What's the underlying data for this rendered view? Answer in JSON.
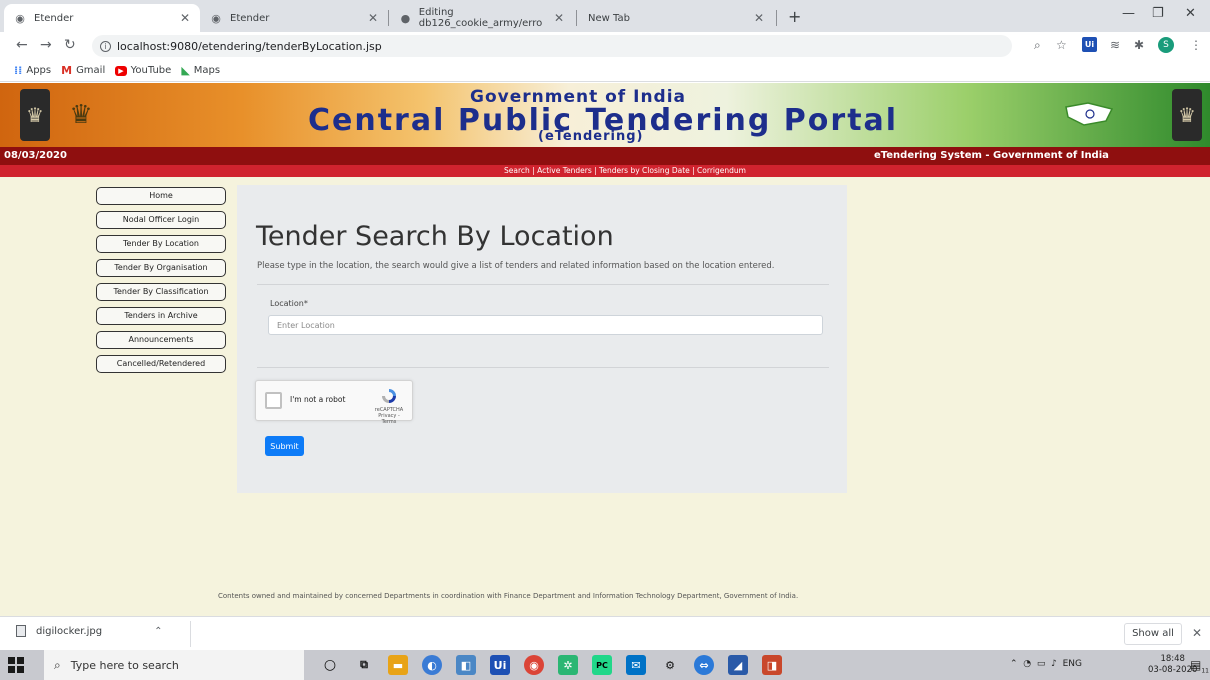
{
  "browser": {
    "tabs": [
      {
        "title": "Etender"
      },
      {
        "title": "Etender"
      },
      {
        "title": "Editing db126_cookie_army/erro"
      },
      {
        "title": "New Tab"
      }
    ],
    "new_tab_label": "+",
    "url": "localhost:9080/etendering/tenderByLocation.jsp",
    "bookmarks": [
      {
        "label": "Apps",
        "icon": "apps-grid-icon"
      },
      {
        "label": "Gmail",
        "icon": "gmail-icon"
      },
      {
        "label": "YouTube",
        "icon": "youtube-icon"
      },
      {
        "label": "Maps",
        "icon": "maps-icon"
      }
    ],
    "profile_initial": "S",
    "ui_extension_label": "Ui"
  },
  "page": {
    "header": {
      "line1": "Government of India",
      "line2": "Central Public Tendering Portal",
      "line3": "(eTendering)"
    },
    "date": "08/03/2020",
    "system_title": "eTendering System - Government of India",
    "links": "Search | Active Tenders | Tenders by Closing Date | Corrigendum",
    "nav": [
      "Home",
      "Nodal Officer Login",
      "Tender By Location",
      "Tender By Organisation",
      "Tender By Classification",
      "Tenders in Archive",
      "Announcements",
      "Cancelled/Retendered"
    ],
    "main": {
      "title": "Tender Search By Location",
      "description": "Please type in the location, the search would give a list of tenders and related information based on the location entered.",
      "location_label": "Location*",
      "location_placeholder": "Enter Location",
      "location_value": "",
      "captcha_text": "I'm not a robot",
      "captcha_brand": "reCAPTCHA",
      "captcha_links": "Privacy - Terms",
      "submit_label": "Submit"
    },
    "footer": "Contents owned and maintained by concerned Departments in coordination with Finance Department and Information Technology Department, Government of India."
  },
  "downloads": {
    "file": "digilocker.jpg",
    "show_all": "Show all"
  },
  "taskbar": {
    "search_placeholder": "Type here to search",
    "tray_lang": "ENG",
    "time": "18:48",
    "date": "03-08-2020",
    "notification_count": "11"
  },
  "colors": {
    "header_dark_red": "#8f0f0f",
    "link_bar_red": "#d0232e",
    "page_bg": "#f5f3dd",
    "submit_blue": "#0d7bf7",
    "title_blue": "#1d2e8c"
  }
}
